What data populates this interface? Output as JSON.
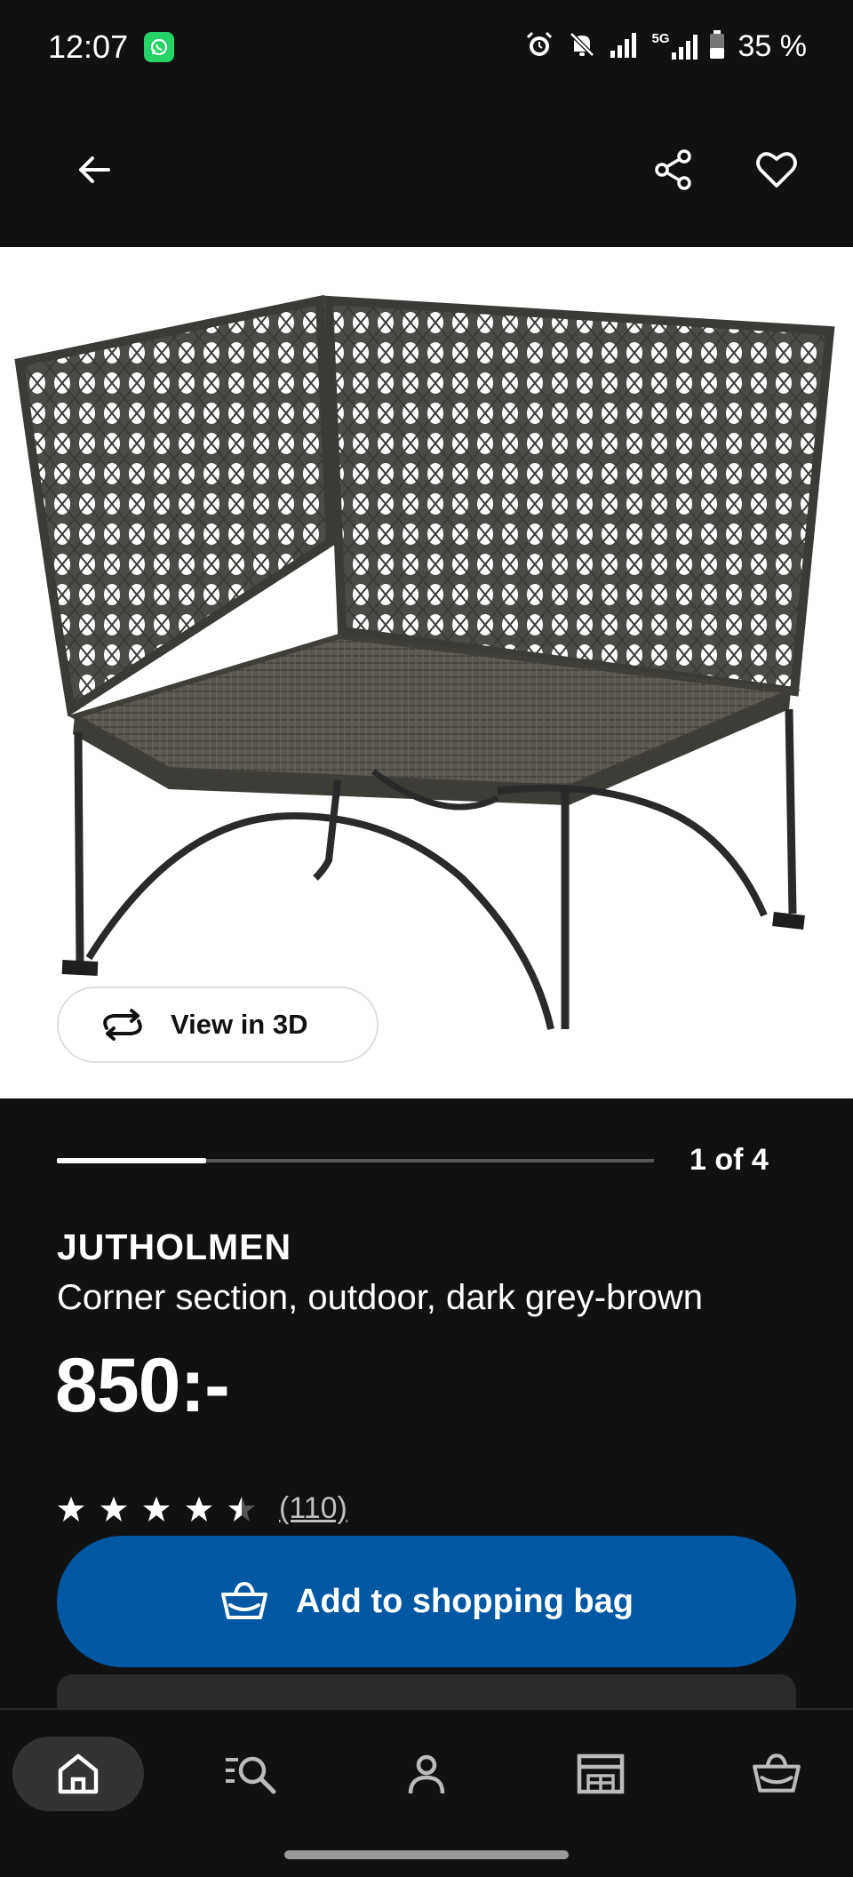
{
  "status_bar": {
    "time": "12:07",
    "network": "5G",
    "battery": "35 %",
    "icons": [
      "whatsapp-icon",
      "alarm-icon",
      "notifications-off-icon",
      "signal-icon",
      "5g-signal-icon",
      "battery-icon"
    ]
  },
  "app_bar": {
    "icons": [
      "back-arrow-icon",
      "share-icon",
      "heart-icon"
    ]
  },
  "media": {
    "view_3d_label": "View in 3D",
    "current_image": 1,
    "total_images": 4,
    "counter_label": "1 of 4",
    "image_alt": "JUTHOLMEN corner section chair"
  },
  "product": {
    "name": "JUTHOLMEN",
    "description": "Corner section, outdoor, dark grey-brown",
    "price": "850:-",
    "rating": 4.5,
    "rating_max": 5,
    "review_count": "(110)"
  },
  "cta": {
    "add_to_bag_label": "Add to shopping bag"
  },
  "bottom_nav": {
    "items": [
      "home",
      "search",
      "profile",
      "store",
      "shopping-bag"
    ],
    "active": "home"
  },
  "colors": {
    "background": "#111111",
    "primary_button": "#0058a3",
    "text": "#ffffff",
    "nav_active": "#333333"
  }
}
